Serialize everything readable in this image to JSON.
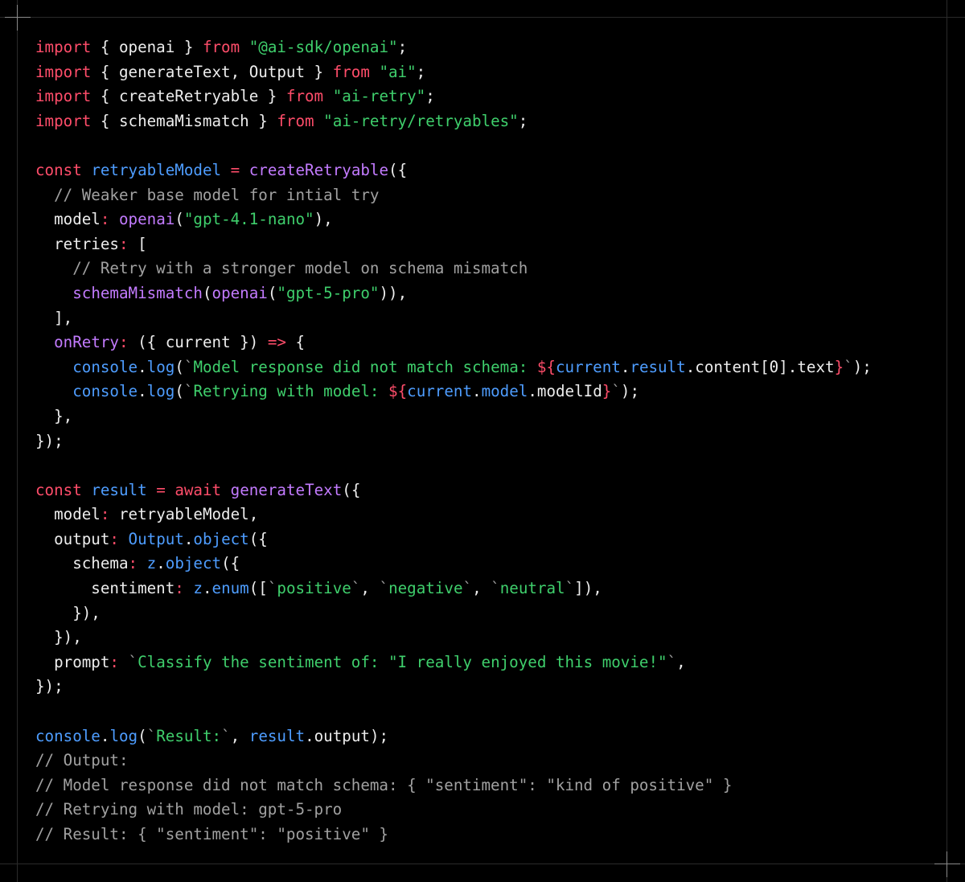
{
  "colors": {
    "background": "#000000",
    "plain": "#ededed",
    "keyword": "#ff4d6a",
    "string": "#3fcf6c",
    "function": "#c37bff",
    "variable": "#4e9dff",
    "comment": "#a1a1a1"
  },
  "code_lines": [
    [
      [
        "keyword",
        "import"
      ],
      [
        "plain",
        " { openai } "
      ],
      [
        "keyword",
        "from"
      ],
      [
        "plain",
        " "
      ],
      [
        "string",
        "\"@ai-sdk/openai\""
      ],
      [
        "plain",
        ";"
      ]
    ],
    [
      [
        "keyword",
        "import"
      ],
      [
        "plain",
        " { generateText, Output } "
      ],
      [
        "keyword",
        "from"
      ],
      [
        "plain",
        " "
      ],
      [
        "string",
        "\"ai\""
      ],
      [
        "plain",
        ";"
      ]
    ],
    [
      [
        "keyword",
        "import"
      ],
      [
        "plain",
        " { createRetryable } "
      ],
      [
        "keyword",
        "from"
      ],
      [
        "plain",
        " "
      ],
      [
        "string",
        "\"ai-retry\""
      ],
      [
        "plain",
        ";"
      ]
    ],
    [
      [
        "keyword",
        "import"
      ],
      [
        "plain",
        " { schemaMismatch } "
      ],
      [
        "keyword",
        "from"
      ],
      [
        "plain",
        " "
      ],
      [
        "string",
        "\"ai-retry/retryables\""
      ],
      [
        "plain",
        ";"
      ]
    ],
    [],
    [
      [
        "keyword",
        "const"
      ],
      [
        "plain",
        " "
      ],
      [
        "var",
        "retryableModel"
      ],
      [
        "plain",
        " "
      ],
      [
        "keyword",
        "="
      ],
      [
        "plain",
        " "
      ],
      [
        "func",
        "createRetryable"
      ],
      [
        "plain",
        "({"
      ]
    ],
    [
      [
        "comment",
        "  // Weaker base model for intial try"
      ]
    ],
    [
      [
        "plain",
        "  model"
      ],
      [
        "keyword",
        ":"
      ],
      [
        "plain",
        " "
      ],
      [
        "func",
        "openai"
      ],
      [
        "plain",
        "("
      ],
      [
        "string",
        "\"gpt-4.1-nano\""
      ],
      [
        "plain",
        "),"
      ]
    ],
    [
      [
        "plain",
        "  retries"
      ],
      [
        "keyword",
        ":"
      ],
      [
        "plain",
        " ["
      ]
    ],
    [
      [
        "comment",
        "    // Retry with a stronger model on schema mismatch"
      ]
    ],
    [
      [
        "plain",
        "    "
      ],
      [
        "func",
        "schemaMismatch"
      ],
      [
        "plain",
        "("
      ],
      [
        "func",
        "openai"
      ],
      [
        "plain",
        "("
      ],
      [
        "string",
        "\"gpt-5-pro\""
      ],
      [
        "plain",
        ")),"
      ]
    ],
    [
      [
        "plain",
        "  ],"
      ]
    ],
    [
      [
        "plain",
        "  "
      ],
      [
        "func",
        "onRetry"
      ],
      [
        "keyword",
        ":"
      ],
      [
        "plain",
        " ({ current }) "
      ],
      [
        "keyword",
        "=>"
      ],
      [
        "plain",
        " {"
      ]
    ],
    [
      [
        "plain",
        "    "
      ],
      [
        "var",
        "console"
      ],
      [
        "plain",
        "."
      ],
      [
        "var",
        "log"
      ],
      [
        "plain",
        "("
      ],
      [
        "tick",
        "`"
      ],
      [
        "string",
        "Model response did not match schema: "
      ],
      [
        "interp",
        "${"
      ],
      [
        "var",
        "current"
      ],
      [
        "plain",
        "."
      ],
      [
        "var",
        "result"
      ],
      [
        "plain",
        ".content[0].text"
      ],
      [
        "interp",
        "}"
      ],
      [
        "tick",
        "`"
      ],
      [
        "plain",
        ");"
      ]
    ],
    [
      [
        "plain",
        "    "
      ],
      [
        "var",
        "console"
      ],
      [
        "plain",
        "."
      ],
      [
        "var",
        "log"
      ],
      [
        "plain",
        "("
      ],
      [
        "tick",
        "`"
      ],
      [
        "string",
        "Retrying with model: "
      ],
      [
        "interp",
        "${"
      ],
      [
        "var",
        "current"
      ],
      [
        "plain",
        "."
      ],
      [
        "var",
        "model"
      ],
      [
        "plain",
        ".modelId"
      ],
      [
        "interp",
        "}"
      ],
      [
        "tick",
        "`"
      ],
      [
        "plain",
        ");"
      ]
    ],
    [
      [
        "plain",
        "  },"
      ]
    ],
    [
      [
        "plain",
        "});"
      ]
    ],
    [],
    [
      [
        "keyword",
        "const"
      ],
      [
        "plain",
        " "
      ],
      [
        "var",
        "result"
      ],
      [
        "plain",
        " "
      ],
      [
        "keyword",
        "="
      ],
      [
        "plain",
        " "
      ],
      [
        "keyword",
        "await"
      ],
      [
        "plain",
        " "
      ],
      [
        "func",
        "generateText"
      ],
      [
        "plain",
        "({"
      ]
    ],
    [
      [
        "plain",
        "  model"
      ],
      [
        "keyword",
        ":"
      ],
      [
        "plain",
        " retryableModel,"
      ]
    ],
    [
      [
        "plain",
        "  output"
      ],
      [
        "keyword",
        ":"
      ],
      [
        "plain",
        " "
      ],
      [
        "var",
        "Output"
      ],
      [
        "plain",
        "."
      ],
      [
        "var",
        "object"
      ],
      [
        "plain",
        "({"
      ]
    ],
    [
      [
        "plain",
        "    schema"
      ],
      [
        "keyword",
        ":"
      ],
      [
        "plain",
        " "
      ],
      [
        "var",
        "z"
      ],
      [
        "plain",
        "."
      ],
      [
        "var",
        "object"
      ],
      [
        "plain",
        "({"
      ]
    ],
    [
      [
        "plain",
        "      sentiment"
      ],
      [
        "keyword",
        ":"
      ],
      [
        "plain",
        " "
      ],
      [
        "var",
        "z"
      ],
      [
        "plain",
        "."
      ],
      [
        "var",
        "enum"
      ],
      [
        "plain",
        "(["
      ],
      [
        "tick",
        "`"
      ],
      [
        "string",
        "positive"
      ],
      [
        "tick",
        "`"
      ],
      [
        "plain",
        ", "
      ],
      [
        "tick",
        "`"
      ],
      [
        "string",
        "negative"
      ],
      [
        "tick",
        "`"
      ],
      [
        "plain",
        ", "
      ],
      [
        "tick",
        "`"
      ],
      [
        "string",
        "neutral"
      ],
      [
        "tick",
        "`"
      ],
      [
        "plain",
        "]),"
      ]
    ],
    [
      [
        "plain",
        "    }),"
      ]
    ],
    [
      [
        "plain",
        "  }),"
      ]
    ],
    [
      [
        "plain",
        "  prompt"
      ],
      [
        "keyword",
        ":"
      ],
      [
        "plain",
        " "
      ],
      [
        "tick",
        "`"
      ],
      [
        "string",
        "Classify the sentiment of: \"I really enjoyed this movie!\""
      ],
      [
        "tick",
        "`"
      ],
      [
        "plain",
        ","
      ]
    ],
    [
      [
        "plain",
        "});"
      ]
    ],
    [],
    [
      [
        "var",
        "console"
      ],
      [
        "plain",
        "."
      ],
      [
        "var",
        "log"
      ],
      [
        "plain",
        "("
      ],
      [
        "tick",
        "`"
      ],
      [
        "string",
        "Result:"
      ],
      [
        "tick",
        "`"
      ],
      [
        "plain",
        ", "
      ],
      [
        "var",
        "result"
      ],
      [
        "plain",
        ".output);"
      ]
    ],
    [
      [
        "comment",
        "// Output:"
      ]
    ],
    [
      [
        "comment",
        "// Model response did not match schema: { \"sentiment\": \"kind of positive\" }"
      ]
    ],
    [
      [
        "comment",
        "// Retrying with model: gpt-5-pro"
      ]
    ],
    [
      [
        "comment",
        "// Result: { \"sentiment\": \"positive\" }"
      ]
    ]
  ]
}
